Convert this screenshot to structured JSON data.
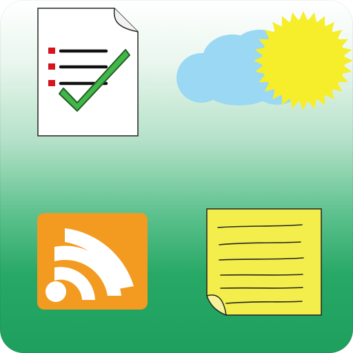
{
  "app": {
    "tiles": [
      {
        "name": "checklist-document-icon",
        "icon": "checklist-document"
      },
      {
        "name": "weather-icon",
        "icon": "sun-and-cloud"
      },
      {
        "name": "rss-feed-icon",
        "icon": "rss-feed"
      },
      {
        "name": "sticky-note-icon",
        "icon": "sticky-note"
      }
    ],
    "colors": {
      "background_top": "#ffffff",
      "background_bottom": "#1e9f5d",
      "rss_orange": "#f39a21",
      "sun_yellow": "#f6ee2a",
      "cloud_blue": "#9ad8f3",
      "note_yellow": "#f3ee4b",
      "check_green": "#43b649",
      "bullet_red": "#d4151d"
    }
  }
}
